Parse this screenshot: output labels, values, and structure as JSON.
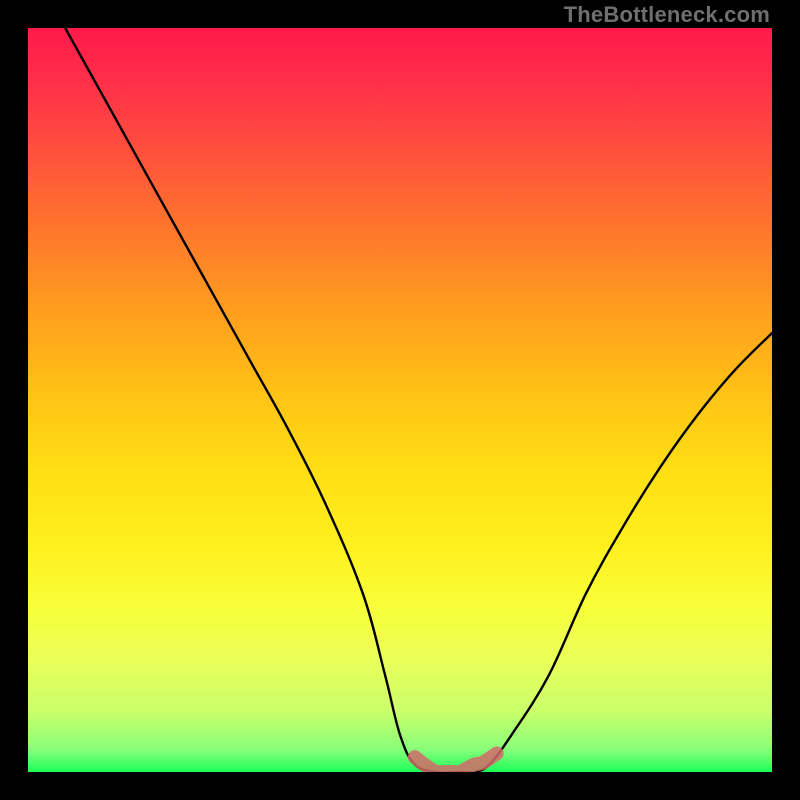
{
  "watermark": "TheBottleneck.com",
  "chart_data": {
    "type": "line",
    "title": "",
    "xlabel": "",
    "ylabel": "",
    "xlim": [
      0,
      100
    ],
    "ylim": [
      0,
      100
    ],
    "grid": false,
    "legend": false,
    "gradient_stops": [
      {
        "pos": 0,
        "color": "#ff1a4a"
      },
      {
        "pos": 6,
        "color": "#ff2b4a"
      },
      {
        "pos": 15,
        "color": "#ff4a3f"
      },
      {
        "pos": 25,
        "color": "#ff6f2f"
      },
      {
        "pos": 37,
        "color": "#ff9a1f"
      },
      {
        "pos": 50,
        "color": "#ffc515"
      },
      {
        "pos": 60,
        "color": "#ffe015"
      },
      {
        "pos": 70,
        "color": "#fff01f"
      },
      {
        "pos": 78,
        "color": "#f8ff3a"
      },
      {
        "pos": 85,
        "color": "#eaff5a"
      },
      {
        "pos": 92,
        "color": "#c8ff6a"
      },
      {
        "pos": 97,
        "color": "#88ff7a"
      },
      {
        "pos": 100,
        "color": "#1bff58"
      }
    ],
    "series": [
      {
        "name": "bottleneck-curve",
        "color": "#000000",
        "x": [
          5,
          10,
          15,
          20,
          25,
          30,
          35,
          40,
          45,
          48,
          50,
          52,
          55,
          58,
          60,
          62,
          65,
          70,
          75,
          80,
          85,
          90,
          95,
          100
        ],
        "y": [
          100,
          91,
          82,
          73,
          64,
          55,
          46,
          36,
          24,
          13,
          5,
          1,
          0,
          0,
          0,
          1,
          5,
          13,
          24,
          33,
          41,
          48,
          54,
          59
        ]
      },
      {
        "name": "optimal-zone",
        "color": "#d46a6a",
        "x": [
          52,
          53,
          54,
          55,
          56,
          57,
          58,
          59,
          60,
          61,
          62,
          63
        ],
        "y": [
          2.0,
          1.2,
          0.5,
          0.0,
          0.0,
          0.0,
          0.0,
          0.5,
          1.0,
          1.2,
          1.8,
          2.5
        ]
      }
    ]
  }
}
